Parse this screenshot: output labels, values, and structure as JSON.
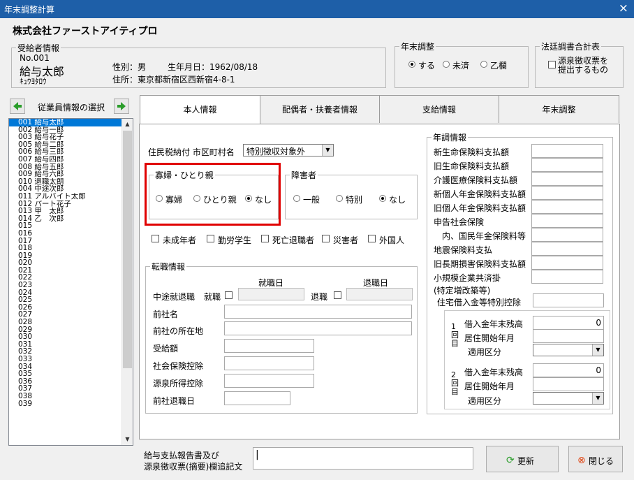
{
  "window": {
    "title": "年末調整計算",
    "close_glyph": "×"
  },
  "company_name": "株式会社ファーストアイティプロ",
  "recipient": {
    "group_label": "受給者情報",
    "number": "No.001",
    "name": "給与太郎",
    "kana": "ｷｭｳﾖﾀﾛｳ",
    "gender_line": "性別：男",
    "birth_line": "生年月日：1962/08/18",
    "address_line": "住所：東京都新宿区西新宿4-8-1"
  },
  "year_end": {
    "group_label": "年末調整",
    "options": [
      "する",
      "未済",
      "乙欄"
    ],
    "selected": "する"
  },
  "legal": {
    "group_label": "法廷調書合計表",
    "checkbox_label_1": "源泉徴収票を",
    "checkbox_label_2": "提出するもの"
  },
  "employee_nav": {
    "label": "従業員情報の選択"
  },
  "employee_list": [
    "001 給与太郎",
    "002 給与一郎",
    "003 給与花子",
    "005 給与二郎",
    "006 給与三郎",
    "007 給与四郎",
    "008 給与五郎",
    "009 給与六郎",
    "010 退職太朗",
    "004 中途次郎",
    "011 アルバイト太郎",
    "012 パート花子",
    "013 甲　太郎",
    "014 乙　次郎",
    "015",
    "016",
    "017",
    "018",
    "019",
    "020",
    "021",
    "022",
    "023",
    "024",
    "025",
    "026",
    "027",
    "028",
    "029",
    "030",
    "031",
    "032",
    "033",
    "034",
    "035",
    "036",
    "037",
    "038",
    "039"
  ],
  "tabs": [
    "本人情報",
    "配偶者・扶養者情報",
    "支給情報",
    "年末調整"
  ],
  "resident_tax": {
    "label": "住民税納付 市区町村名",
    "value": "特別徴収対象外"
  },
  "widow": {
    "group_label": "寡婦・ひとり親",
    "options": [
      "寡婦",
      "ひとり親",
      "なし"
    ],
    "selected": "なし"
  },
  "disability": {
    "group_label": "障害者",
    "options": [
      "一般",
      "特別",
      "なし"
    ],
    "selected": "なし"
  },
  "flags": [
    "未成年者",
    "勤労学生",
    "死亡退職者",
    "災害者",
    "外国人"
  ],
  "job_change": {
    "group_label": "転職情報",
    "hire_date_header": "就職日",
    "retire_date_header": "退職日",
    "midyear_label": "中途就退職",
    "hire_label": "就職",
    "retire_label": "退職",
    "fields": [
      "前社名",
      "前社の所在地",
      "受給額",
      "社会保険控除",
      "源泉所得控除",
      "前社退職日"
    ]
  },
  "annual": {
    "group_label": "年調情報",
    "items": [
      "新生命保険料支払額",
      "旧生命保険料支払額",
      "介護医療保険料支払額",
      "新個人年金保険料支払額",
      "旧個人年金保険料支払額",
      "申告社会保険",
      "　内、国民年金保険料等",
      "地震保険料支払",
      "旧長期損害保険料支払額",
      "小規模企業共済掛"
    ],
    "housing_note": "(特定増改築等)",
    "housing_label": "住宅借入金等特別控除",
    "loan_1_vertical": "1回目",
    "loan_2_vertical": "2回目",
    "loan_balance_label": "借入金年末残高",
    "move_in_label": "居住開始年月",
    "category_label": "適用区分",
    "loan_1_balance": "0",
    "loan_2_balance": "0"
  },
  "footer": {
    "note_label_1": "給与支払報告書及び",
    "note_label_2": "源泉徴収票(摘要)欄追記文",
    "note_value": "|",
    "update_label": "更新",
    "close_label": "閉じる"
  },
  "colors": {
    "title_bar": "#1e5fa8",
    "selection": "#0078d7",
    "highlight_box": "#e00000"
  }
}
